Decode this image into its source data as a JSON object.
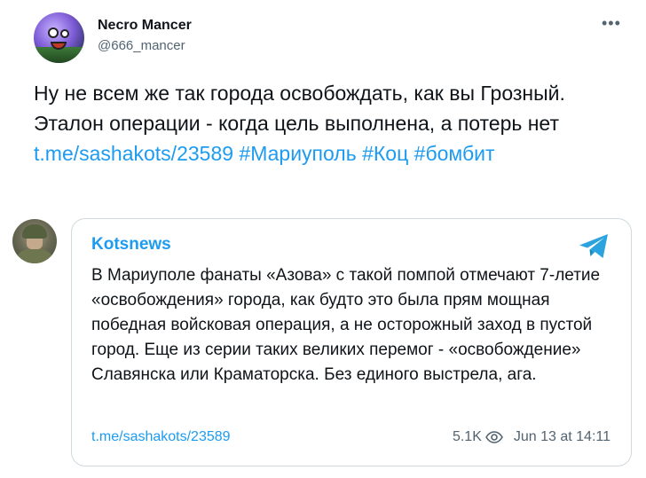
{
  "author": {
    "display_name": "Necro Mancer",
    "handle": "@666_mancer",
    "avatar_icon": "cartoon-monster-avatar"
  },
  "more_label": "•••",
  "tweet": {
    "text_before": "Ну не всем же так города освобождать, как вы Грозный. Эталон операции - когда цель выполнена, а потерь нет ",
    "link": "t.me/sashakots/23589",
    "hashtag1": "#Мариуполь",
    "hashtag2": "#Коц",
    "hashtag3": "#бомбит"
  },
  "card": {
    "channel": "Kotsnews",
    "avatar_icon": "soldier-avatar",
    "text": "В Мариуполе фанаты «Азова» с такой помпой отмечают 7-летие «освобождения» города, как будто это была прям мощная победная войсковая операция, а не осторожный заход в пустой город. Еще из серии таких великих перемог - «освобождение» Славянска или Краматорска. Без единого выстрела, ага.",
    "link": "t.me/sashakots/23589",
    "views": "5.1K",
    "timestamp": "Jun 13 at 14:11",
    "source_icon": "telegram-icon"
  },
  "colors": {
    "accent": "#1d9bf0",
    "text": "#0f1419",
    "muted": "#536471",
    "border": "#cfd9de"
  }
}
